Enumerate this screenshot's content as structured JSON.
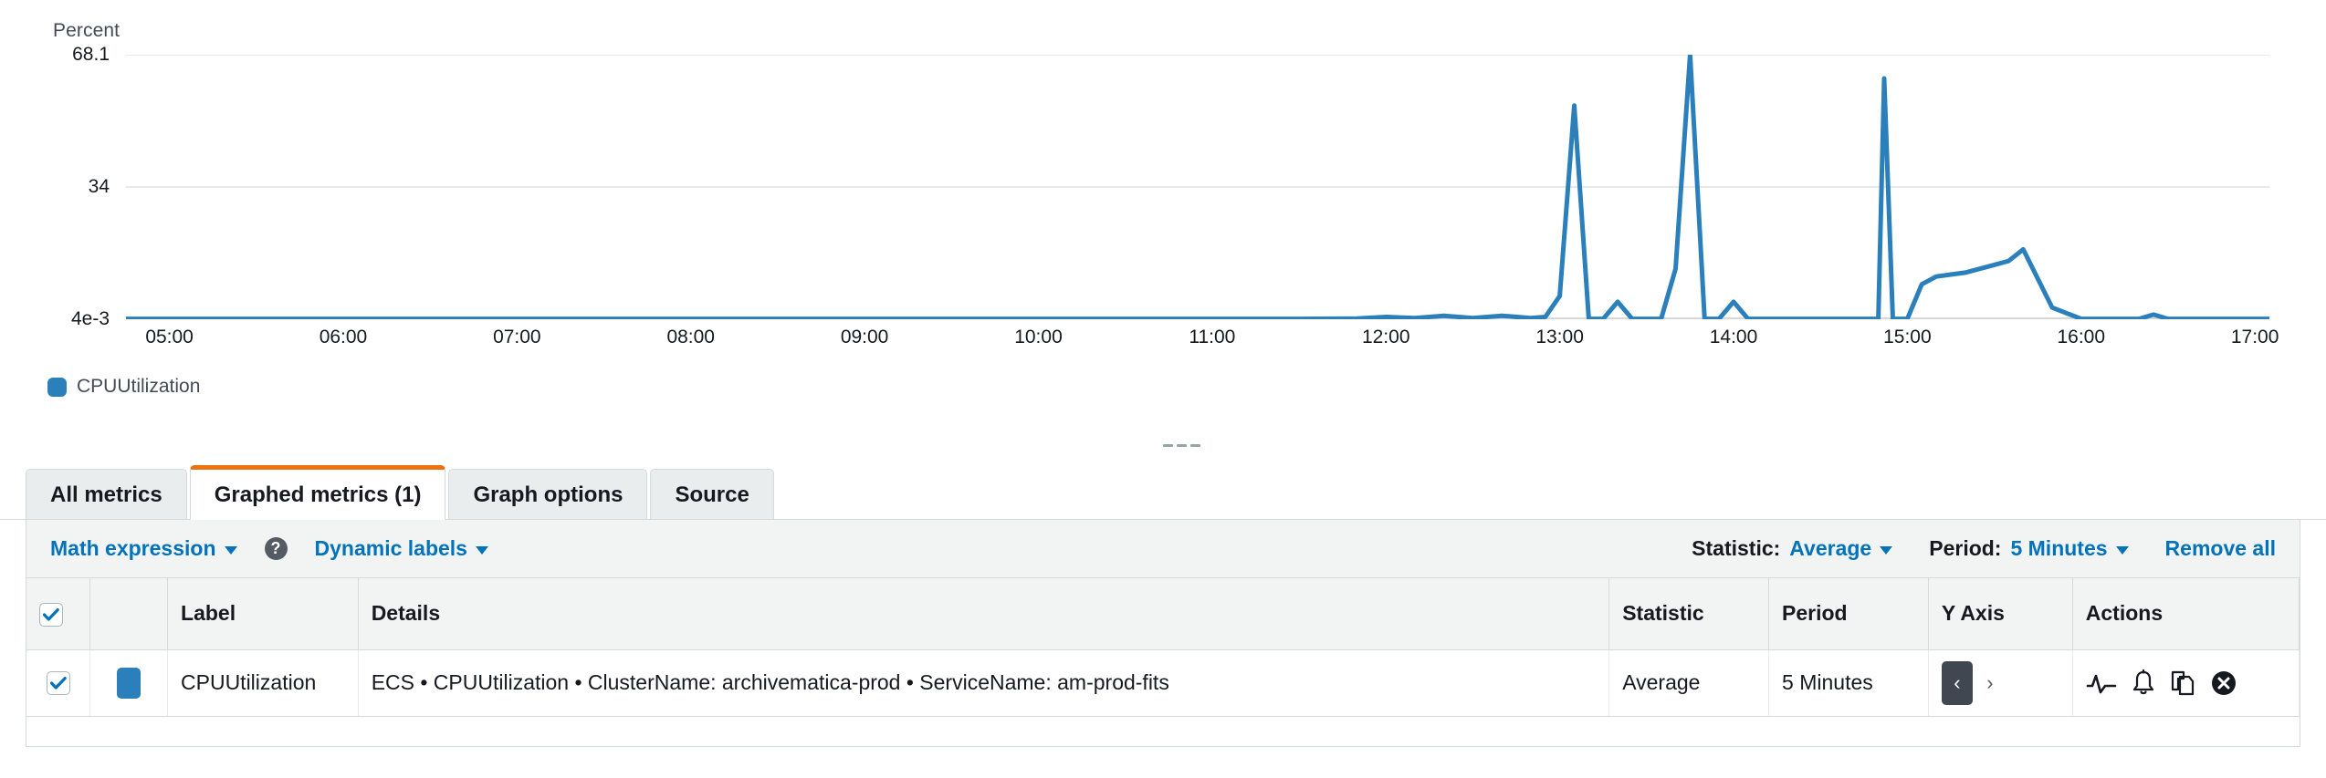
{
  "chart": {
    "y_axis_title": "Percent",
    "legend": [
      {
        "label": "CPUUtilization",
        "color": "#2b7fba"
      }
    ],
    "resize_grip": "resize-grip"
  },
  "chart_data": {
    "type": "line",
    "title": "",
    "subtitle": "",
    "xlabel": "",
    "ylabel": "Percent",
    "grid": true,
    "legend_position": "bottom-left",
    "ytick_labels": [
      "68.1",
      "34",
      "4e-3"
    ],
    "ytick_values": [
      68.1,
      34,
      0.004
    ],
    "ylim": [
      0.004,
      68.1
    ],
    "xtick_labels": [
      "05:00",
      "06:00",
      "07:00",
      "08:00",
      "09:00",
      "10:00",
      "11:00",
      "12:00",
      "13:00",
      "14:00",
      "15:00",
      "16:00",
      "17:00"
    ],
    "xlim": [
      "04:45",
      "17:05"
    ],
    "series": [
      {
        "name": "CPUUtilization",
        "color": "#2b7fba",
        "statistic": "Average",
        "period": "5 Minutes",
        "x": [
          "04:45",
          "05:00",
          "06:00",
          "07:00",
          "08:00",
          "09:00",
          "10:00",
          "11:00",
          "11:30",
          "11:50",
          "12:00",
          "12:10",
          "12:20",
          "12:30",
          "12:40",
          "12:50",
          "12:55",
          "13:00",
          "13:05",
          "13:10",
          "13:15",
          "13:20",
          "13:25",
          "13:30",
          "13:35",
          "13:40",
          "13:45",
          "13:50",
          "13:55",
          "14:00",
          "14:05",
          "14:10",
          "14:15",
          "14:20",
          "14:30",
          "14:40",
          "14:45",
          "14:50",
          "14:52",
          "14:55",
          "15:00",
          "15:05",
          "15:10",
          "15:15",
          "15:20",
          "15:25",
          "15:30",
          "15:35",
          "15:40",
          "15:50",
          "16:00",
          "16:10",
          "16:20",
          "16:25",
          "16:30",
          "16:40",
          "16:50",
          "17:00",
          "17:05"
        ],
        "y": [
          0.1,
          0.1,
          0.1,
          0.1,
          0.1,
          0.1,
          0.1,
          0.1,
          0.1,
          0.2,
          0.6,
          0.3,
          0.9,
          0.3,
          0.9,
          0.3,
          0.6,
          6.0,
          55.0,
          0.1,
          0.1,
          4.5,
          0.1,
          0.1,
          0.1,
          13.0,
          68.1,
          0.1,
          0.1,
          4.5,
          0.1,
          0.1,
          0.1,
          0.1,
          0.1,
          0.1,
          0.1,
          0.1,
          62.0,
          0.1,
          0.1,
          9.0,
          11.0,
          11.5,
          12.0,
          13.0,
          14.0,
          15.0,
          18.0,
          3.0,
          0.1,
          0.1,
          0.1,
          1.2,
          0.1,
          0.1,
          0.1,
          0.1,
          0.1
        ]
      }
    ]
  },
  "tabs": [
    {
      "label": "All metrics",
      "active": false
    },
    {
      "label": "Graphed metrics (1)",
      "active": true
    },
    {
      "label": "Graph options",
      "active": false
    },
    {
      "label": "Source",
      "active": false
    }
  ],
  "toolbar": {
    "math_expression": "Math expression",
    "help_glyph": "?",
    "dynamic_labels": "Dynamic labels",
    "statistic_label": "Statistic:",
    "statistic_value": "Average",
    "period_label": "Period:",
    "period_value": "5 Minutes",
    "remove_all": "Remove all"
  },
  "table": {
    "columns": [
      "",
      "",
      "Label",
      "Details",
      "Statistic",
      "Period",
      "Y Axis",
      "Actions"
    ],
    "header_checkbox_checked": true,
    "rows": [
      {
        "checked": true,
        "color": "#2b7fba",
        "label": "CPUUtilization",
        "details": "ECS • CPUUtilization • ClusterName: archivematica-prod • ServiceName: am-prod-fits",
        "statistic": "Average",
        "period": "5 Minutes",
        "y_axis_left": "‹",
        "y_axis_right": "›",
        "y_axis_selected": "left",
        "actions": [
          "metric-math-icon",
          "alarm-bell-icon",
          "duplicate-icon",
          "remove-icon"
        ]
      }
    ]
  },
  "colors": {
    "series_blue": "#2b7fba",
    "accent_orange": "#ec7211",
    "link_blue": "#0073bb",
    "toolbar_bg": "#f2f3f3",
    "border": "#d5dbdb"
  }
}
